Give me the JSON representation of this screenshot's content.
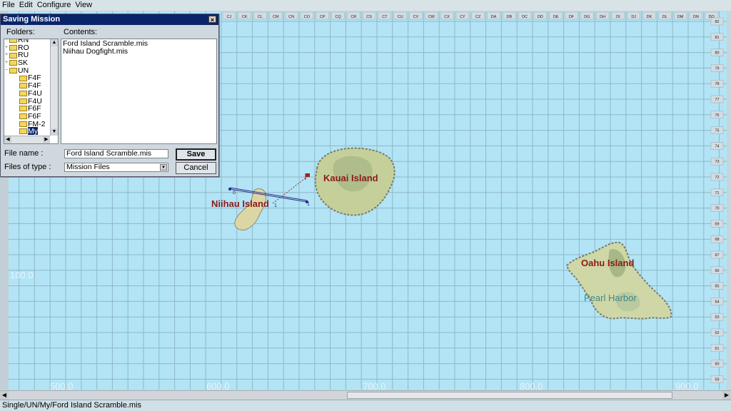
{
  "menubar": {
    "items": [
      "File",
      "Edit",
      "Configure",
      "View"
    ]
  },
  "map": {
    "column_labels": [
      "CJ",
      "CK",
      "CL",
      "CM",
      "CN",
      "CO",
      "CP",
      "CQ",
      "CR",
      "CS",
      "CT",
      "CU",
      "CV",
      "CW",
      "CX",
      "CY",
      "CZ",
      "DA",
      "DB",
      "DC",
      "DD",
      "DE",
      "DF",
      "DG",
      "DH",
      "DI",
      "DJ",
      "DK",
      "DL",
      "DM",
      "DN",
      "DO"
    ],
    "row_labels": [
      "82",
      "81",
      "80",
      "79",
      "78",
      "77",
      "76",
      "75",
      "74",
      "73",
      "72",
      "71",
      "70",
      "69",
      "68",
      "67",
      "66",
      "65",
      "64",
      "63",
      "62",
      "61",
      "60",
      "59"
    ],
    "bottom_coords": [
      "500.0",
      "600.0",
      "700.0",
      "800.0",
      "900.0"
    ],
    "left_coord": "100.0",
    "islands": [
      {
        "name": "Kauai Island"
      },
      {
        "name": "Niihau Island"
      },
      {
        "name": "Oahu Island"
      }
    ],
    "place_label": "Pearl Harbor",
    "waypoint_labels": [
      "0",
      "1",
      "1"
    ],
    "colors": {
      "sea": "#b2e4f6",
      "grid": "#8fb7c6",
      "land": "#cfd7a6",
      "island_label": "#8b1a1a",
      "coord": "#e7f4fa"
    }
  },
  "dialog": {
    "title": "Saving Mission",
    "close_glyph": "×",
    "folders_label": "Folders:",
    "contents_label": "Contents:",
    "folders": [
      {
        "label": "RN",
        "indent": 0,
        "expander": "+"
      },
      {
        "label": "RO",
        "indent": 0,
        "expander": "+"
      },
      {
        "label": "RU",
        "indent": 0,
        "expander": "+"
      },
      {
        "label": "SK",
        "indent": 0,
        "expander": "+"
      },
      {
        "label": "UN",
        "indent": 0,
        "expander": "−"
      },
      {
        "label": "F4F",
        "indent": 1,
        "expander": ""
      },
      {
        "label": "F4F",
        "indent": 1,
        "expander": ""
      },
      {
        "label": "F4U",
        "indent": 1,
        "expander": ""
      },
      {
        "label": "F4U",
        "indent": 1,
        "expander": ""
      },
      {
        "label": "F6F",
        "indent": 1,
        "expander": ""
      },
      {
        "label": "F6F",
        "indent": 1,
        "expander": ""
      },
      {
        "label": "FM-2",
        "indent": 1,
        "expander": ""
      },
      {
        "label": "My",
        "indent": 1,
        "expander": "",
        "selected": true
      }
    ],
    "contents": [
      "Ford Island Scramble.mis",
      "Niihau Dogfight.mis"
    ],
    "file_name_label": "File name :",
    "file_name_value": "Ford Island Scramble.mis",
    "file_type_label": "Files of type :",
    "file_type_value": "Mission Files",
    "save_label": "Save",
    "cancel_label": "Cancel"
  },
  "statusbar": {
    "path": "Single/UN/My/Ford Island Scramble.mis"
  }
}
